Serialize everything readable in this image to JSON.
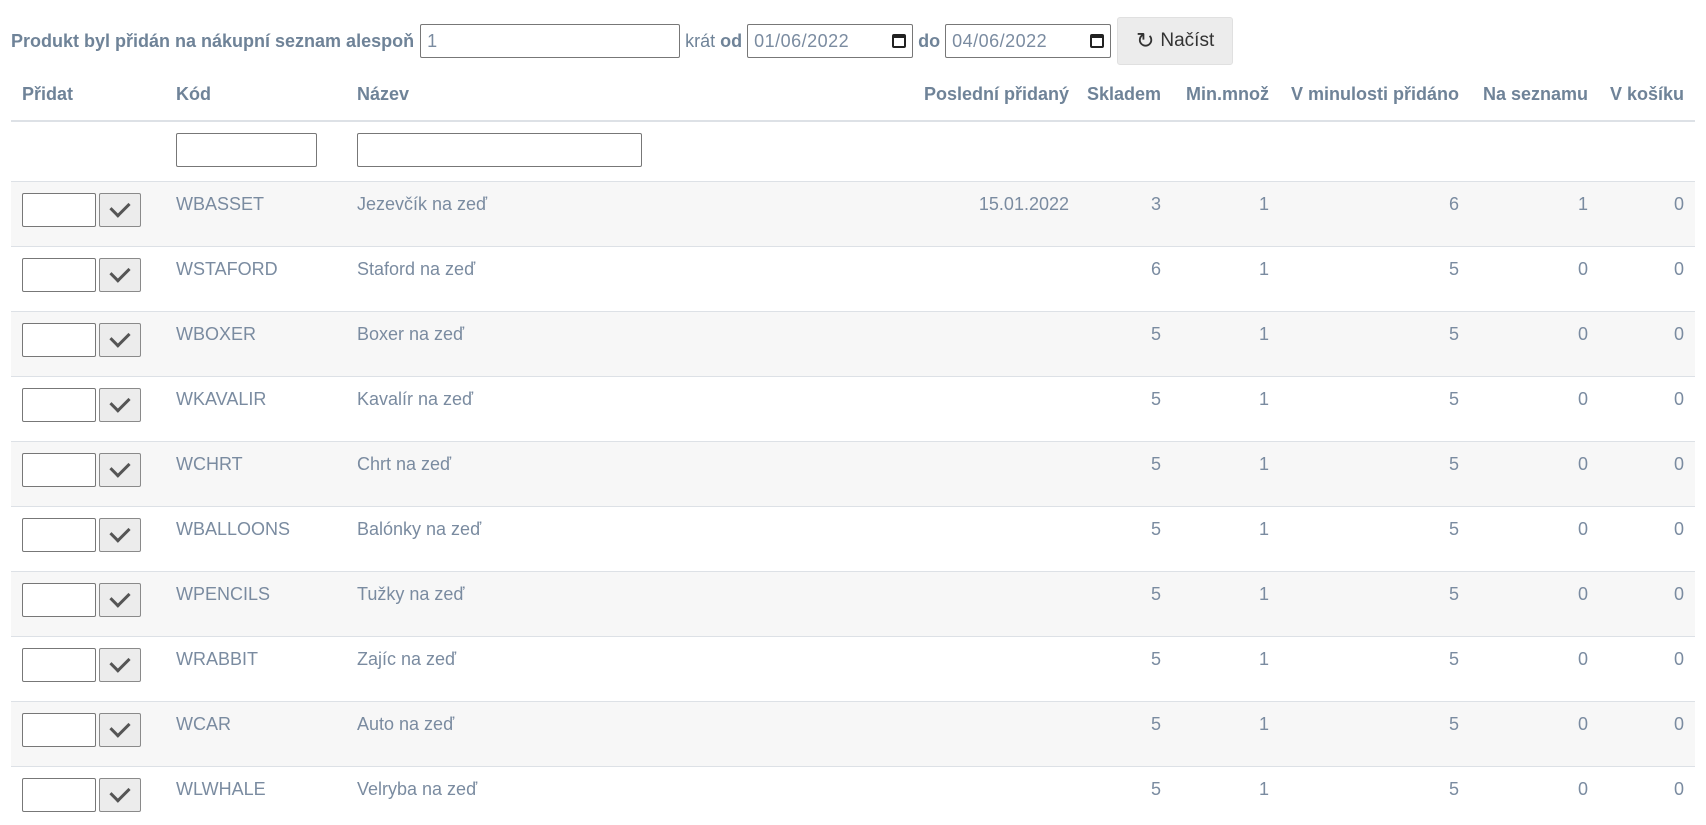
{
  "filter": {
    "label": "Produkt byl přidán na nákupní seznam alespoň",
    "count_value": "1",
    "times_label": "krát",
    "from_label": "od",
    "from_date": "01/06/2022",
    "to_label": "do",
    "to_date": "04/06/2022",
    "load_button": "Načíst",
    "load_icon": "refresh-icon"
  },
  "table": {
    "headers": {
      "add": "Přidat",
      "code": "Kód",
      "name": "Název",
      "last_added": "Poslední přidaný",
      "in_stock": "Skladem",
      "min_qty": "Min.množ",
      "added_in_past": "V minulosti přidáno",
      "on_list": "Na seznamu",
      "in_cart": "V košíku"
    },
    "filters": {
      "code": "",
      "name": ""
    },
    "rows": [
      {
        "code": "WBASSET",
        "name": "Jezevčík na zeď",
        "last_added": "15.01.2022",
        "in_stock": "3",
        "min_qty": "1",
        "added_in_past": "6",
        "on_list": "1",
        "in_cart": "0"
      },
      {
        "code": "WSTAFORD",
        "name": "Staford na zeď",
        "last_added": "",
        "in_stock": "6",
        "min_qty": "1",
        "added_in_past": "5",
        "on_list": "0",
        "in_cart": "0"
      },
      {
        "code": "WBOXER",
        "name": "Boxer na zeď",
        "last_added": "",
        "in_stock": "5",
        "min_qty": "1",
        "added_in_past": "5",
        "on_list": "0",
        "in_cart": "0"
      },
      {
        "code": "WKAVALIR",
        "name": "Kavalír na zeď",
        "last_added": "",
        "in_stock": "5",
        "min_qty": "1",
        "added_in_past": "5",
        "on_list": "0",
        "in_cart": "0"
      },
      {
        "code": "WCHRT",
        "name": "Chrt na zeď",
        "last_added": "",
        "in_stock": "5",
        "min_qty": "1",
        "added_in_past": "5",
        "on_list": "0",
        "in_cart": "0"
      },
      {
        "code": "WBALLOONS",
        "name": "Balónky na zeď",
        "last_added": "",
        "in_stock": "5",
        "min_qty": "1",
        "added_in_past": "5",
        "on_list": "0",
        "in_cart": "0"
      },
      {
        "code": "WPENCILS",
        "name": "Tužky na zeď",
        "last_added": "",
        "in_stock": "5",
        "min_qty": "1",
        "added_in_past": "5",
        "on_list": "0",
        "in_cart": "0"
      },
      {
        "code": "WRABBIT",
        "name": "Zajíc na zeď",
        "last_added": "",
        "in_stock": "5",
        "min_qty": "1",
        "added_in_past": "5",
        "on_list": "0",
        "in_cart": "0"
      },
      {
        "code": "WCAR",
        "name": "Auto na zeď",
        "last_added": "",
        "in_stock": "5",
        "min_qty": "1",
        "added_in_past": "5",
        "on_list": "0",
        "in_cart": "0"
      },
      {
        "code": "WLWHALE",
        "name": "Velryba na zeď",
        "last_added": "",
        "in_stock": "5",
        "min_qty": "1",
        "added_in_past": "5",
        "on_list": "0",
        "in_cart": "0"
      }
    ]
  },
  "colors": {
    "text": "#7a8ba0",
    "header_text": "#6f8398",
    "striped_row": "#f7f7f7",
    "border": "#dde1e6",
    "button_bg": "#ececec"
  },
  "icons": {
    "confirm": "check-icon",
    "date": "calendar-icon"
  }
}
